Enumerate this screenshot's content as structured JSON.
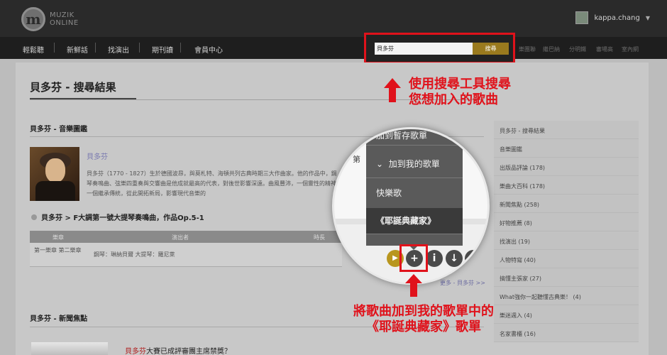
{
  "brand": {
    "line1": "MUZIK",
    "line2": "ONLINE",
    "mark": "m"
  },
  "user": {
    "name": "kappa.chang",
    "caret": "▼"
  },
  "nav": {
    "items": [
      "輕鬆聽",
      "新鮮話",
      "找演出",
      "期刊讀",
      "會員中心"
    ]
  },
  "topright": {
    "items": [
      "樂團聯",
      "繼巴納",
      "分明鐵",
      "審場高",
      "室內網"
    ]
  },
  "search": {
    "value": "貝多芬",
    "button": "搜尋"
  },
  "page": {
    "title": "貝多芬 - 搜尋結果",
    "section1": "貝多芬 - 音樂圖鑑",
    "composer_link": "貝多芬",
    "composer_desc": "貝多芬（1770 - 1827）生於德國波昂，與莫札特、海頓共列古典時期三大作曲家。他的作品中，鋼琴奏鳴曲、弦樂四重奏與交響曲是他成就最高的代表，對後世影響深遠。曲風豐沛，一個靈性的精神，一個繼承傳統，從此開拓新局，影響現代音樂的",
    "breadcrumb": "貝多芬 > F大調第一號大提琴奏鳴曲，作品Op.5-1",
    "table": {
      "headers": [
        "樂章",
        "演出者",
        "時長"
      ],
      "row": {
        "movement": "第一樂章 第二樂章",
        "performers": "鋼琴：琳納貝爾 大提琴：羅尼萊"
      }
    },
    "more_link": "更多 - 貝多芬 >>",
    "section2": "貝多芬 - 新聞焦點",
    "news": {
      "highlight": "貝多芬",
      "rest": "大賽已成評審團主席禁獎？"
    }
  },
  "sidebar": {
    "items": [
      "貝多芬 - 搜尋結果",
      "音樂圖鑑",
      "出版品評論 (178)",
      "樂曲大百科 (178)",
      "新聞焦點 (258)",
      "好物推薦 (8)",
      "找演出 (19)",
      "人物特寫 (40)",
      "搞懂主張家 (27)",
      "What強你一起聽懂古典樂！ (4)",
      "樂迷週入 (4)",
      "名家書櫃 (16)"
    ]
  },
  "magnifier": {
    "menu_item_1": "加到暫存歌單",
    "menu_item_2": "加到我的歌單",
    "menu_item_2_chevron": "⌄",
    "playlist_1": "快樂歌",
    "playlist_2": "《耶誕典藏家》",
    "bg_text": "第",
    "controls": {
      "play": "▶",
      "add": "+",
      "info": "i",
      "download": "↓"
    }
  },
  "annotations": {
    "search_note_line1": "使用搜尋工具搜尋",
    "search_note_line2": "您想加入的歌曲",
    "add_note_line1": "將歌曲加到我的歌單中的",
    "add_note_line2": "《耶誕典藏家》歌單",
    "color": "#e0121b"
  }
}
